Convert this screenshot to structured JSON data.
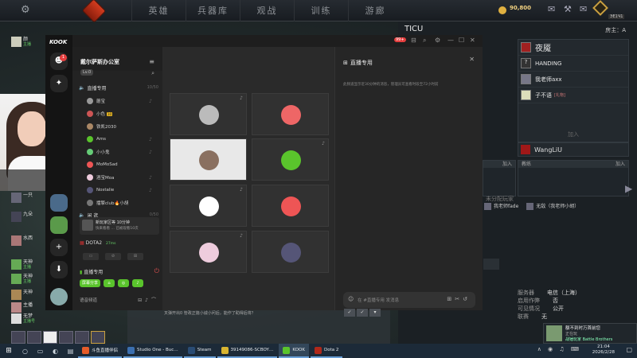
{
  "dota": {
    "nav": [
      "英雄",
      "兵器库",
      "观战",
      "训练",
      "游廊"
    ],
    "gold": "90,800",
    "gold_sub": "",
    "badge": "ЭЕ1Ч1",
    "lobby": {
      "title": "TICU",
      "host_label": "房主：A",
      "players": [
        {
          "name": "夜魇",
          "tag": ""
        },
        {
          "name": "HANDING",
          "tag": ""
        },
        {
          "name": "我老师axx",
          "tag": ""
        },
        {
          "name": "子不语",
          "tag": "[礼物]"
        }
      ],
      "join": "加入",
      "slot_player": "WangLiU",
      "slot_coach_label": "教练",
      "slot_join": "加入",
      "unassigned_label": "未分配玩家",
      "unassigned": [
        "我老师fade",
        "无敌（我老师小胡）"
      ],
      "info": [
        {
          "k": "服务器",
          "v": "电信（上海）"
        },
        {
          "k": "启用作弊",
          "v": "否"
        },
        {
          "k": "可见情况",
          "v": "公开"
        },
        {
          "k": "联赛",
          "v": "无"
        }
      ]
    },
    "notif": {
      "line1": "额不到时万首前您",
      "line2": "正在玩",
      "line3": "战锤玩家 Battle Brothers"
    }
  },
  "left_chat": [
    {
      "name": "颜",
      "sub": "主播"
    },
    {
      "name": "一只",
      "sub": ""
    },
    {
      "name": "九朵",
      "sub": ""
    },
    {
      "name": "水西",
      "sub": ""
    },
    {
      "name": "天神",
      "sub": "主播"
    },
    {
      "name": "天神",
      "sub": "主播"
    },
    {
      "name": "天神",
      "sub": ""
    },
    {
      "name": "主播",
      "sub": ""
    },
    {
      "name": "无梦",
      "sub": "主播号"
    }
  ],
  "kook": {
    "logo": "KOOK",
    "badge": "99+",
    "rail_badge": "1",
    "server_name": "戴尔萨斯办公室",
    "level": "Lv.0",
    "channel1": {
      "name": "直播专用",
      "count": "10/50"
    },
    "members": [
      {
        "name": "蘑宝",
        "lvl": ""
      },
      {
        "name": "小色",
        "lvl": "10"
      },
      {
        "name": "铁凯2030",
        "lvl": ""
      },
      {
        "name": "Ams",
        "lvl": ""
      },
      {
        "name": "小小鬼",
        "lvl": ""
      },
      {
        "name": "MoMoSad",
        "lvl": ""
      },
      {
        "name": "酒宝Moa",
        "lvl": ""
      },
      {
        "name": "Nostalie",
        "lvl": ""
      },
      {
        "name": "擂擎club🔥小胡",
        "lvl": ""
      }
    ],
    "channel2": {
      "name": "闲 逛",
      "count": "0/50"
    },
    "bar": {
      "line1": "新玩家区等 10分钟",
      "line2": "快来看看 … 已被观看10次"
    },
    "game": {
      "name": "DOTA2",
      "time": "27ms"
    },
    "voice_channel": "直播专用",
    "green_buttons": [
      "屏幕分享",
      "⌂",
      "◎",
      "♪"
    ],
    "bottom_label": "语音频道",
    "chat": {
      "title": "直播专用",
      "desc": "此频道显示近30分钟的消息，管理员可查看时段至72小时前",
      "placeholder": "在 #直播专用 发消息"
    }
  },
  "bg_text": "叉弹开出0 管政正篇小诚小问后，能作了助得后将？",
  "taskbar": {
    "apps": [
      {
        "label": "斗鱼直播伴侣",
        "color": "#e65c2a"
      },
      {
        "label": "Studio One - Buc…",
        "color": "#3b6fb0"
      },
      {
        "label": "Steam",
        "color": "#2a4c74"
      },
      {
        "label": "39149086-SCBOY…",
        "color": "#d8b430"
      },
      {
        "label": "KOOK",
        "color": "#5ac42c"
      },
      {
        "label": "Dota 2",
        "color": "#b0281a"
      }
    ],
    "time": "21:04",
    "date": "2026/2/28"
  }
}
